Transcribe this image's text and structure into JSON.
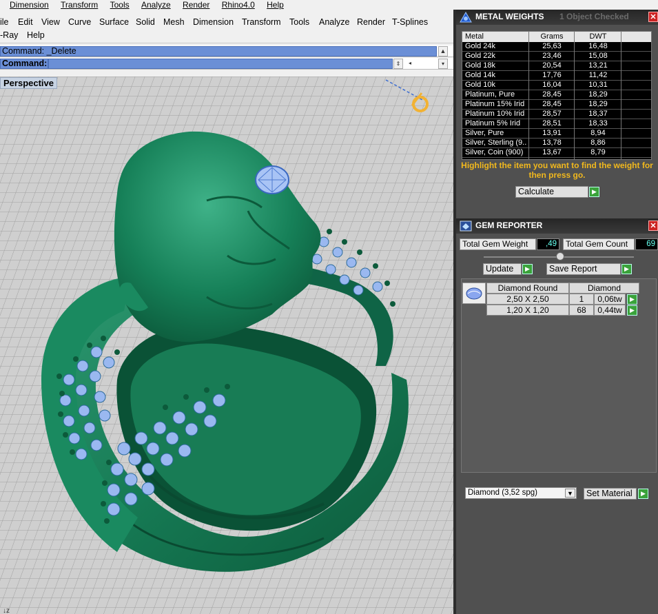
{
  "menu_top": [
    "Dimension",
    "Transform",
    "Tools",
    "Analyze",
    "Render",
    "Rhino4.0",
    "Help"
  ],
  "menu_main": [
    "ile",
    "Edit",
    "View",
    "Curve",
    "Surface",
    "Solid",
    "Mesh",
    "Dimension",
    "Transform",
    "Tools",
    "Analyze",
    "Render",
    "T-Splines"
  ],
  "menu_main2": [
    "-Ray",
    "Help"
  ],
  "command": {
    "history": "Command: _Delete",
    "prompt": "Command:"
  },
  "viewport": {
    "title": "Perspective"
  },
  "metal_weights": {
    "title": "METAL WEIGHTS",
    "status": "1 Object Checked",
    "headers": [
      "Metal",
      "Grams",
      "DWT"
    ],
    "rows": [
      {
        "metal": "Gold 24k",
        "grams": "25,63",
        "dwt": "16,48"
      },
      {
        "metal": "Gold 22k",
        "grams": "23,46",
        "dwt": "15,08"
      },
      {
        "metal": "Gold 18k",
        "grams": "20,54",
        "dwt": "13,21"
      },
      {
        "metal": "Gold 14k",
        "grams": "17,76",
        "dwt": "11,42"
      },
      {
        "metal": "Gold 10k",
        "grams": "16,04",
        "dwt": "10,31"
      },
      {
        "metal": "Platinum, Pure",
        "grams": "28,45",
        "dwt": "18,29"
      },
      {
        "metal": "Platinum 15% Irid",
        "grams": "28,45",
        "dwt": "18,29"
      },
      {
        "metal": "Platinum 10% Irid",
        "grams": "28,57",
        "dwt": "18,37"
      },
      {
        "metal": "Platinum 5% Irid",
        "grams": "28,51",
        "dwt": "18,33"
      },
      {
        "metal": "Silver, Pure",
        "grams": "13,91",
        "dwt": "8,94"
      },
      {
        "metal": "Silver, Sterling (9...",
        "grams": "13,78",
        "dwt": "8,86"
      },
      {
        "metal": "Silver, Coin (900)",
        "grams": "13,67",
        "dwt": "8,79"
      }
    ],
    "hint": "Highlight the item you want to find the weight for then press go.",
    "calculate": "Calculate"
  },
  "gem_reporter": {
    "title": "GEM REPORTER",
    "total_weight_label": "Total Gem Weight",
    "total_weight": ",49",
    "total_count_label": "Total Gem Count",
    "total_count": "69",
    "update": "Update",
    "save_report": "Save Report",
    "gem_name": "Diamond Round",
    "gem_material": "Diamond",
    "rows": [
      {
        "size": "2,50 X 2,50",
        "count": "1",
        "weight": "0,06tw"
      },
      {
        "size": "1,20 X 1,20",
        "count": "68",
        "weight": "0,44tw"
      }
    ],
    "material_select": "Diamond    (3,52 spg)",
    "set_material": "Set Material"
  }
}
